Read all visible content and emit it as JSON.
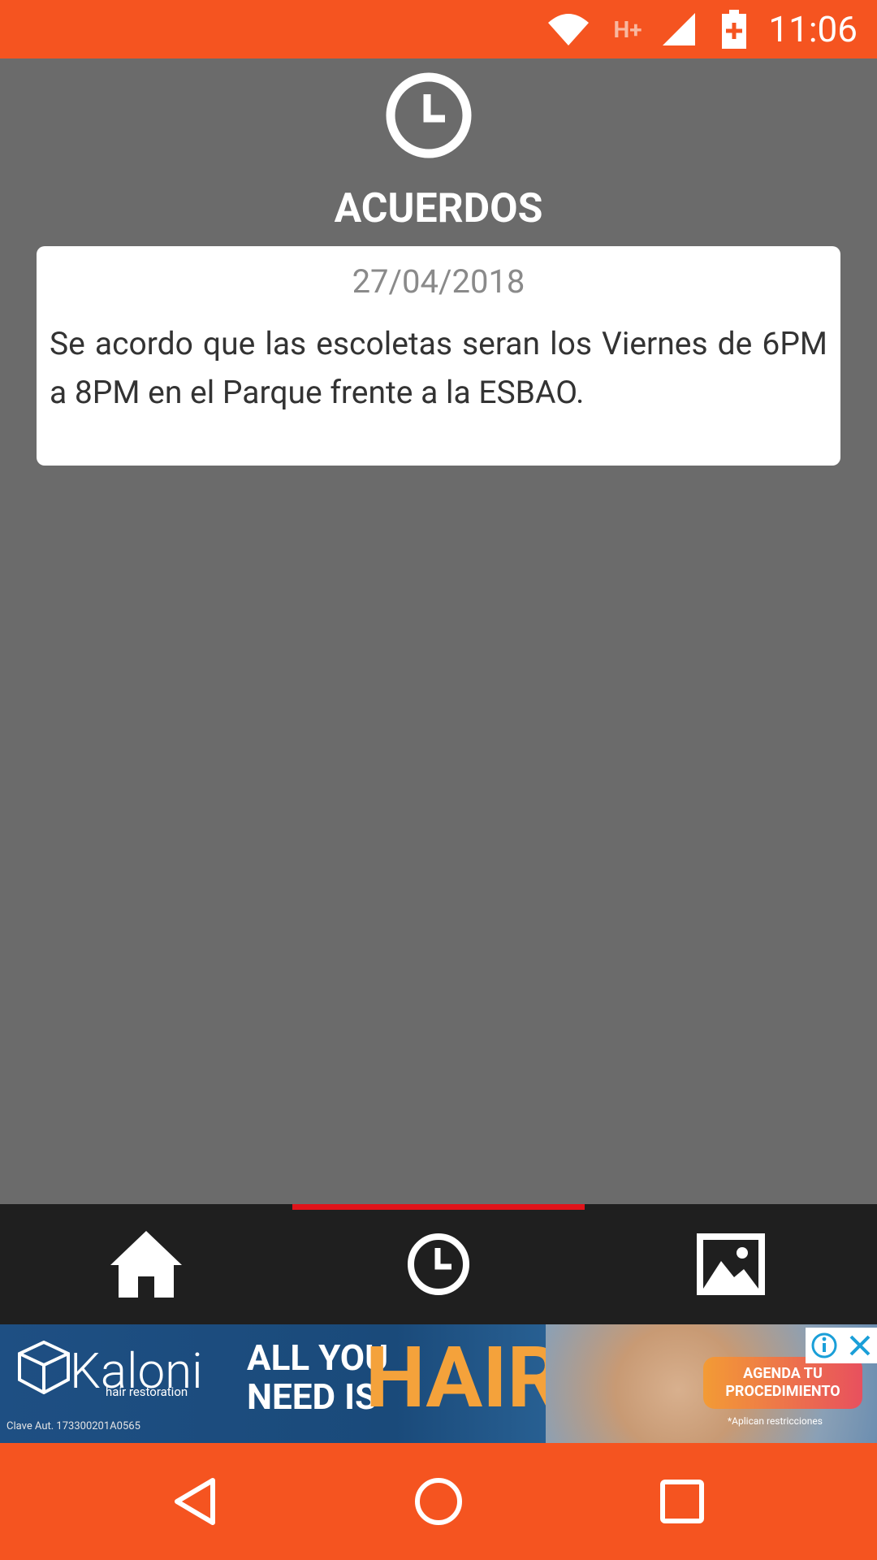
{
  "status_bar": {
    "time": "11:06",
    "network_type": "H+",
    "icons": [
      "wifi-icon",
      "network-type-icon",
      "cell-signal-icon",
      "battery-charging-icon"
    ]
  },
  "header": {
    "icon": "clock-icon",
    "title": "ACUERDOS"
  },
  "agreements": [
    {
      "date": "27/04/2018",
      "text": "Se acordo que las escoletas seran los Viernes de 6PM a 8PM en el Parque frente a la ESBAO."
    }
  ],
  "tab_bar": {
    "tabs": [
      {
        "icon": "home-icon",
        "active": false
      },
      {
        "icon": "clock-icon",
        "active": true
      },
      {
        "icon": "image-icon",
        "active": false
      }
    ],
    "active_indicator_color": "#e0131a"
  },
  "ad_banner": {
    "brand": "Kaloni",
    "brand_sub": "hair restoration",
    "slogan_line1": "ALL YOU",
    "slogan_line2": "NEED IS",
    "slogan_big": "HAIR",
    "cta": "AGENDA TU PROCEDIMIENTO",
    "legal": "Clave Aut. 173300201A0565",
    "restrictions": "*Aplican restricciones"
  },
  "nav_bar": {
    "buttons": [
      "back-icon",
      "home-circle-icon",
      "recents-icon"
    ]
  },
  "colors": {
    "accent": "#f55420",
    "background": "#6b6b6b",
    "tab_bar": "#1f1f1f",
    "card": "#ffffff"
  }
}
